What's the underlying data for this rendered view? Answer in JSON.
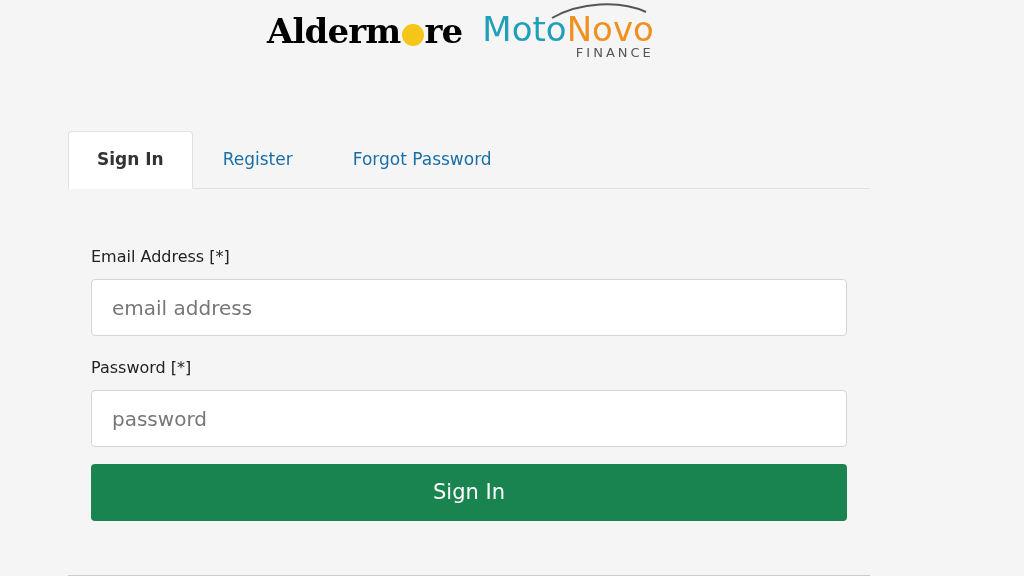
{
  "logos": {
    "aldermore_start": "Alderm",
    "aldermore_end": "re",
    "motonovo_first": "Moto",
    "motonovo_second": "Novo",
    "motonovo_sub": "FINANCE"
  },
  "tabs": [
    {
      "label": "Sign In",
      "selected": true
    },
    {
      "label": "Register",
      "selected": false
    },
    {
      "label": "Forgot Password",
      "selected": false
    }
  ],
  "fields": [
    {
      "label": "Email Address [*]",
      "placeholder": "email address"
    },
    {
      "label": "Password [*]",
      "placeholder": "password"
    }
  ],
  "submit": "Sign In"
}
